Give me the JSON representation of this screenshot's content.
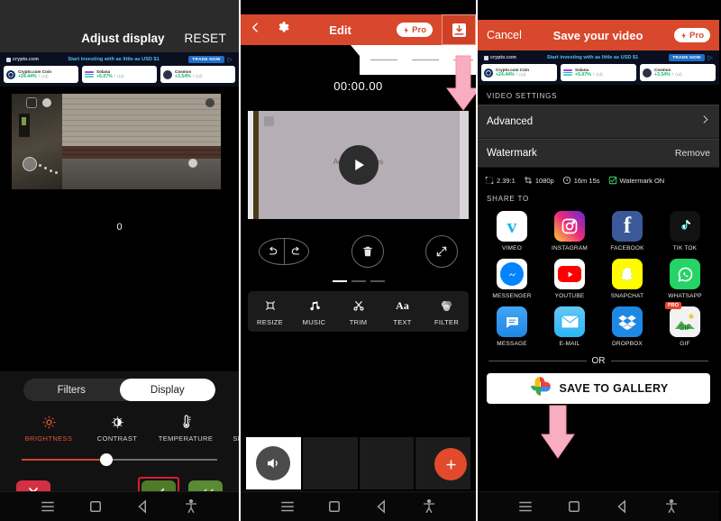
{
  "ad": {
    "brand": "crypto.com",
    "headline": "Start investing with as little as USD $1",
    "cta": "TRADE NOW",
    "coins": [
      {
        "name": "Crypto.com Coin",
        "change": "+24.44%",
        "period": "(1d)",
        "icon": "crypto-com-coin-icon"
      },
      {
        "name": "Solana",
        "change": "+5.07%",
        "period": "(1d)",
        "icon": "solana-icon"
      },
      {
        "name": "Cosmos",
        "change": "+3.54%",
        "period": "(1d)",
        "icon": "cosmos-icon"
      }
    ]
  },
  "navbar": {
    "items": [
      {
        "name": "menu-icon",
        "label": "Menu"
      },
      {
        "name": "home-icon",
        "label": "Home"
      },
      {
        "name": "back-icon",
        "label": "Back"
      },
      {
        "name": "accessibility-icon",
        "label": "Accessibility"
      }
    ]
  },
  "panel1": {
    "title": "Adjust display",
    "reset_label": "RESET",
    "value": "0",
    "tabs": [
      {
        "label": "Filters",
        "active": false
      },
      {
        "label": "Display",
        "active": true
      }
    ],
    "adjustments": [
      {
        "label": "BRIGHTNESS",
        "icon": "brightness-icon",
        "active": true
      },
      {
        "label": "CONTRAST",
        "icon": "contrast-icon",
        "active": false
      },
      {
        "label": "TEMPERATURE",
        "icon": "temperature-icon",
        "active": false
      },
      {
        "label": "SH",
        "icon": "sharpen-icon",
        "active": false
      }
    ],
    "slider": {
      "percent": 42
    },
    "buttons": {
      "cancel": "cancel-x-button",
      "apply": "apply-check-button",
      "apply_all": "apply-all-double-check-button"
    }
  },
  "panel2": {
    "toolbar": {
      "back": "back-chevron-icon",
      "settings": "gear-icon",
      "title": "Edit",
      "pro_label": "Pro",
      "export": "export-save-icon"
    },
    "timecode": "00:00.00",
    "preview": {
      "watermark_text": "Add Your Notes",
      "play": "play-button"
    },
    "controls": [
      {
        "name": "undo-icon"
      },
      {
        "name": "redo-icon"
      },
      {
        "name": "delete-trash-icon"
      },
      {
        "name": "fullscreen-expand-icon"
      }
    ],
    "menu": [
      {
        "label": "RESIZE",
        "icon": "resize-icon"
      },
      {
        "label": "MUSIC",
        "icon": "music-note-icon"
      },
      {
        "label": "TRIM",
        "icon": "scissors-icon"
      },
      {
        "label": "TEXT",
        "icon": "text-aa-icon"
      },
      {
        "label": "FILTER",
        "icon": "filter-circles-icon"
      }
    ],
    "timeline": {
      "clip_icon": "speaker-volume-icon",
      "add_label": "+"
    },
    "pages": {
      "total": 3,
      "current": 1
    }
  },
  "panel3": {
    "toolbar": {
      "cancel": "Cancel",
      "title": "Save your video",
      "pro_label": "Pro"
    },
    "video_settings_header": "VIDEO SETTINGS",
    "rows": [
      {
        "label": "Advanced",
        "action": "",
        "icon": "chevron-right-icon"
      },
      {
        "label": "Watermark",
        "action": "Remove",
        "icon": ""
      }
    ],
    "meta": [
      {
        "label": "2.39:1",
        "icon": "aspect-ratio-icon"
      },
      {
        "label": "1080p",
        "icon": "crop-resolution-icon"
      },
      {
        "label": "16m 15s",
        "icon": "clock-icon"
      },
      {
        "label": "Watermark ON",
        "icon": "checkbox-checked-icon"
      }
    ],
    "share_header": "SHARE TO",
    "share_targets": [
      {
        "label": "VIMEO",
        "icon": "vimeo-icon",
        "color": "#ffffff"
      },
      {
        "label": "INSTAGRAM",
        "icon": "instagram-icon",
        "color": "#d6249f"
      },
      {
        "label": "FACEBOOK",
        "icon": "facebook-icon",
        "color": "#3b5998"
      },
      {
        "label": "TIK TOK",
        "icon": "tiktok-icon",
        "color": "#111111"
      },
      {
        "label": "MESSENGER",
        "icon": "messenger-icon",
        "color": "#0084ff"
      },
      {
        "label": "YOUTUBE",
        "icon": "youtube-icon",
        "color": "#ffffff"
      },
      {
        "label": "SNAPCHAT",
        "icon": "snapchat-icon",
        "color": "#fffc00"
      },
      {
        "label": "WHATSAPP",
        "icon": "whatsapp-icon",
        "color": "#25d366"
      },
      {
        "label": "MESSAGE",
        "icon": "message-icon",
        "color": "#2196f3"
      },
      {
        "label": "E-MAIL",
        "icon": "email-icon",
        "color": "#4fc3f7"
      },
      {
        "label": "DROPBOX",
        "icon": "dropbox-icon",
        "color": "#1e88e5"
      },
      {
        "label": "GIF",
        "icon": "gif-icon",
        "color": "#f5f5f5",
        "badge": "PRO"
      }
    ],
    "or_label": "OR",
    "save_button": {
      "label": "SAVE TO GALLERY",
      "icon": "google-photos-icon"
    }
  },
  "colors": {
    "orange_bar": "#d8482c",
    "green_apply": "#4f7a28",
    "red_cancel": "#d32f45",
    "highlight_box": "#d81d32",
    "arrow_pink": "#f9aec0"
  }
}
